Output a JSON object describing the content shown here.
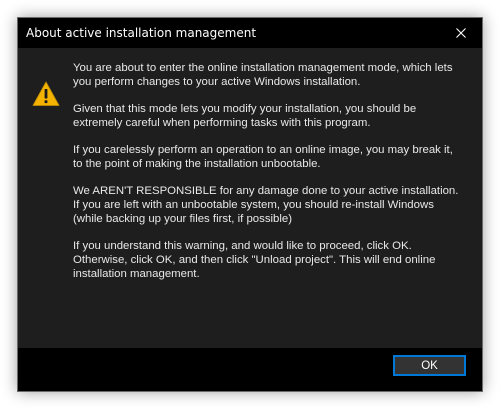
{
  "dialog": {
    "title": "About active installation management",
    "close_icon": "close-icon",
    "warning_icon": "warning-icon",
    "paragraphs": [
      "You are about to enter the online installation management mode, which lets you perform changes to your active Windows installation.",
      "Given that this mode lets you modify your installation, you should be extremely careful when performing tasks with this program.",
      "If you carelessly perform an operation to an online image, you may break it, to the point of making the installation unbootable.",
      "We AREN'T RESPONSIBLE for any damage done to your active installation. If you are left with an unbootable system, you should re-install Windows (while backing up your files first, if possible)",
      "If you understand this warning, and would like to proceed, click OK. Otherwise, click OK, and then click \"Unload project\". This will end online installation management."
    ],
    "ok_label": "OK"
  },
  "colors": {
    "title_bar": "#000000",
    "content_bg": "#1e1e1e",
    "text": "#e8e8e8",
    "accent": "#0078d7",
    "warning": "#f3b300"
  }
}
